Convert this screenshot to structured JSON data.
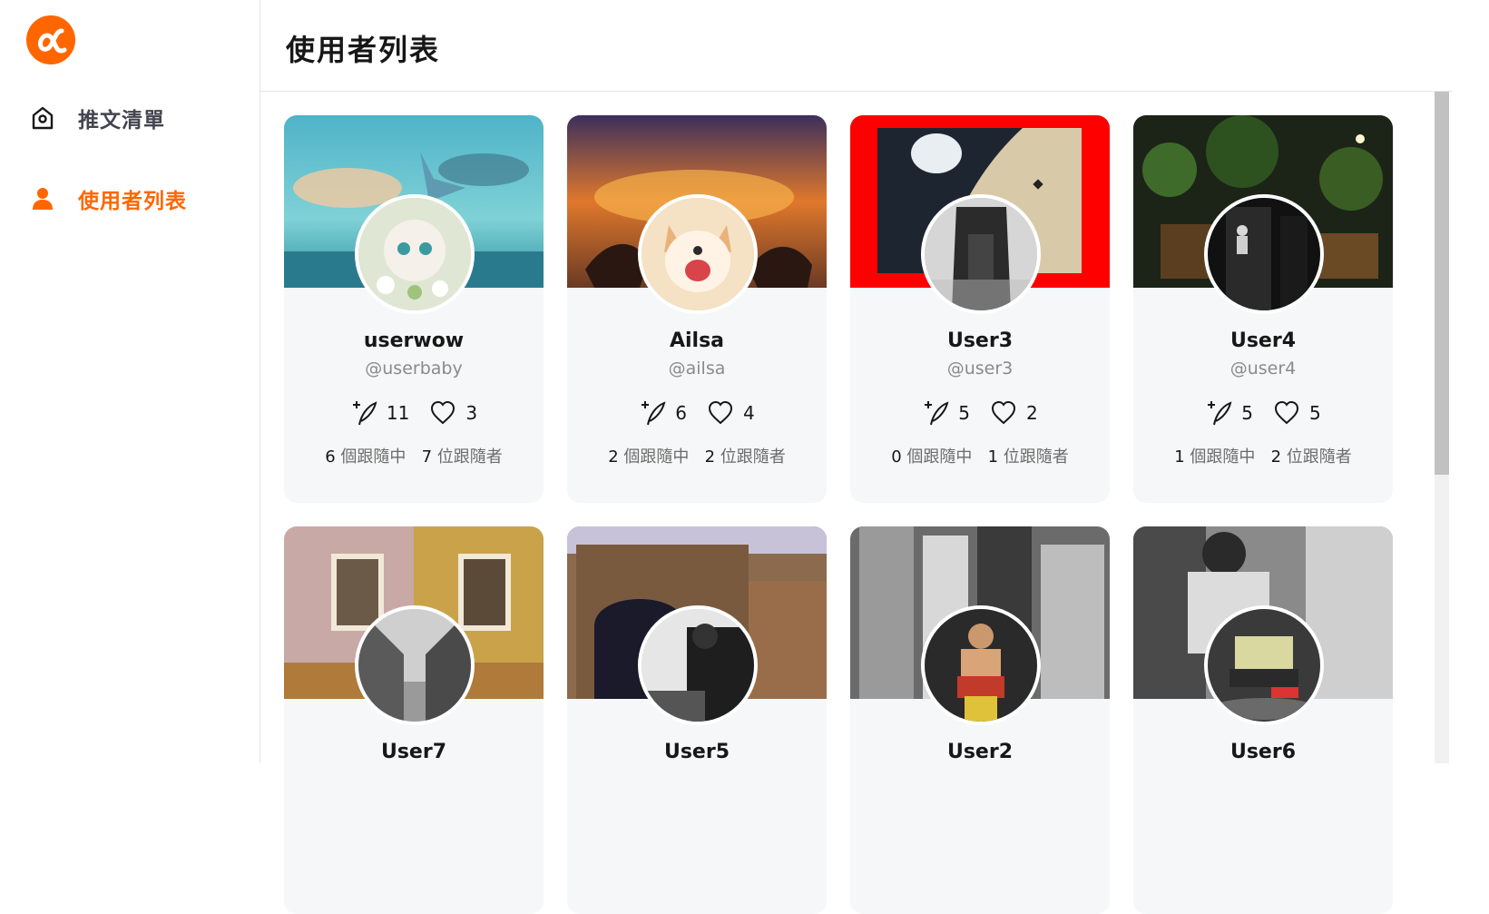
{
  "sidebar": {
    "logo": "alpha-logo",
    "items": [
      {
        "label": "推文清單",
        "icon": "home-icon",
        "active": false
      },
      {
        "label": "使用者列表",
        "icon": "user-icon",
        "active": true
      }
    ]
  },
  "header": {
    "title": "使用者列表"
  },
  "colors": {
    "accent": "#ff6600",
    "card_bg": "#f6f7f8",
    "muted": "#8a8a8a"
  },
  "users": [
    {
      "name": "userwow",
      "handle": "@userbaby",
      "tweets": "11",
      "likes": "3",
      "following_count": "6",
      "following_text": "個跟隨中",
      "followers_count": "7",
      "followers_text": "位跟隨者"
    },
    {
      "name": "Ailsa",
      "handle": "@ailsa",
      "tweets": "6",
      "likes": "4",
      "following_count": "2",
      "following_text": "個跟隨中",
      "followers_count": "2",
      "followers_text": "位跟隨者"
    },
    {
      "name": "User3",
      "handle": "@user3",
      "tweets": "5",
      "likes": "2",
      "following_count": "0",
      "following_text": "個跟隨中",
      "followers_count": "1",
      "followers_text": "位跟隨者"
    },
    {
      "name": "User4",
      "handle": "@user4",
      "tweets": "5",
      "likes": "5",
      "following_count": "1",
      "following_text": "個跟隨中",
      "followers_count": "2",
      "followers_text": "位跟隨者"
    },
    {
      "name": "User7"
    },
    {
      "name": "User5"
    },
    {
      "name": "User2"
    },
    {
      "name": "User6"
    }
  ]
}
